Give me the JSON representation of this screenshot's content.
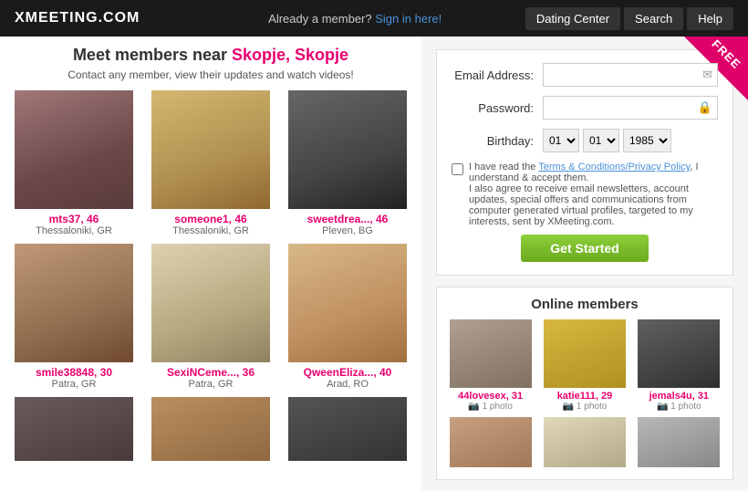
{
  "header": {
    "logo": "XMEETING.COM",
    "already_text": "Already a member?",
    "sign_in_label": "Sign in here!",
    "nav": [
      {
        "label": "Dating Center",
        "id": "dating-center"
      },
      {
        "label": "Search",
        "id": "search"
      },
      {
        "label": "Help",
        "id": "help"
      }
    ]
  },
  "left": {
    "headline_pre": "Meet members near ",
    "city": "Skopje, Skopje",
    "subline": "Contact any member, view their updates and watch videos!",
    "members": [
      {
        "name": "mts37",
        "age": "46",
        "location": "Thessaloniki, GR",
        "photo_class": "photo-1"
      },
      {
        "name": "someone1",
        "age": "46",
        "location": "Thessaloniki, GR",
        "photo_class": "photo-2"
      },
      {
        "name": "sweetdrea...",
        "age": "46",
        "location": "Pleven, BG",
        "photo_class": "photo-3"
      },
      {
        "name": "smile38848",
        "age": "30",
        "location": "Patra, GR",
        "photo_class": "photo-4"
      },
      {
        "name": "SexiNCeme...",
        "age": "36",
        "location": "Patra, GR",
        "photo_class": "photo-5"
      },
      {
        "name": "QweenEliza...",
        "age": "40",
        "location": "Arad, RO",
        "photo_class": "photo-6"
      },
      {
        "name": "",
        "age": "",
        "location": "",
        "photo_class": "photo-7"
      },
      {
        "name": "",
        "age": "",
        "location": "",
        "photo_class": "photo-8"
      },
      {
        "name": "",
        "age": "",
        "location": "",
        "photo_class": "photo-9"
      }
    ]
  },
  "right": {
    "free_badge": "FREE",
    "form": {
      "email_label": "Email Address:",
      "email_placeholder": "",
      "password_label": "Password:",
      "password_placeholder": "",
      "birthday_label": "Birthday:",
      "birthday_month_default": "01",
      "birthday_day_default": "01",
      "birthday_year_default": "1985",
      "terms_pre": "I have read the ",
      "terms_link": "Terms & Conditions/Privacy Policy",
      "terms_post": ", I understand & accept them.",
      "terms_extra": "I also agree to receive email newsletters, account updates, special offers and communications from computer generated virtual profiles, targeted to my interests, sent by XMeeting.com.",
      "get_started_label": "Get Started"
    },
    "online_section": {
      "title": "Online members",
      "members": [
        {
          "name": "44lovesex",
          "age": "31",
          "photos": "1 photo",
          "photo_class": "op-1"
        },
        {
          "name": "katie111",
          "age": "29",
          "photos": "1 photo",
          "photo_class": "op-2"
        },
        {
          "name": "jemals4u",
          "age": "31",
          "photos": "1 photo",
          "photo_class": "op-3"
        },
        {
          "name": "",
          "age": "",
          "photos": "",
          "photo_class": "op-4"
        },
        {
          "name": "",
          "age": "",
          "photos": "",
          "photo_class": "op-5"
        },
        {
          "name": "",
          "age": "",
          "photos": "",
          "photo_class": "op-6"
        }
      ]
    }
  }
}
